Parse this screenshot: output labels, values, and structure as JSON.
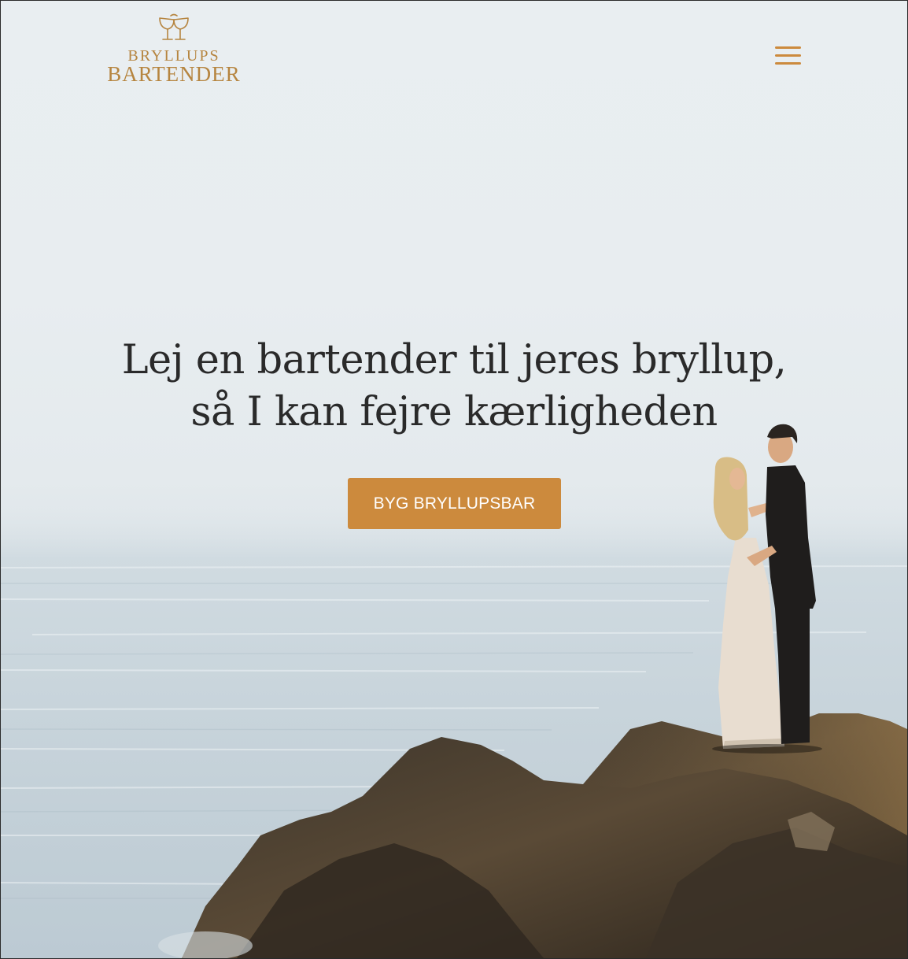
{
  "header": {
    "logo": {
      "icon": "champagne-glasses-icon",
      "line1": "BRYLLUPS",
      "line2": "BARTENDER"
    },
    "menu_icon": "hamburger-menu-icon"
  },
  "hero": {
    "title_line1": "Lej en bartender til jeres bryllup,",
    "title_line2": "så I kan fejre kærligheden",
    "cta_label": "BYG BRYLLUPSBAR",
    "background_image": "couple-on-coastal-cliff"
  },
  "colors": {
    "accent": "#cc8a3d",
    "logo_gold": "#b68540",
    "heading": "#2a2a2a",
    "sky": "#e8edf0"
  }
}
